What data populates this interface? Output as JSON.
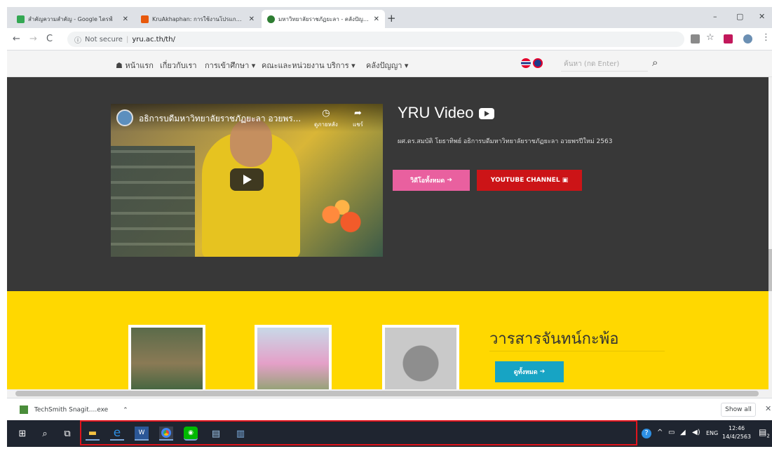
{
  "browser": {
    "tabs": [
      {
        "title": "สำคัญความสำคัญ - Google ไดรฟ์",
        "color": "#34a853",
        "active": false
      },
      {
        "title": "KruAkhaphan: การใช้งานโปรแกรม Fr",
        "color": "#e8590c",
        "active": false
      },
      {
        "title": "มหาวิทยาลัยราชภัฏยะลา - คลังปัญญา",
        "color": "#2e7d32",
        "active": true
      }
    ],
    "new_tab": "+",
    "window_controls": {
      "minimize": "–",
      "maximize": "▢",
      "close": "✕"
    },
    "nav": {
      "back": "←",
      "forward": "→",
      "reload": "C"
    },
    "address": {
      "security_label": "Not secure",
      "url": "yru.ac.th/th/"
    }
  },
  "site_nav": {
    "items": [
      {
        "label": "หน้าแรก",
        "home": true
      },
      {
        "label": "เกี่ยวกับเรา",
        "dropdown": false
      },
      {
        "label": "การเข้าศึกษา",
        "dropdown": true
      },
      {
        "label": "คณะและหน่วยงาน",
        "dropdown": false
      },
      {
        "label": "บริการ",
        "dropdown": true
      },
      {
        "label": "คลังปัญญา",
        "dropdown": true
      }
    ],
    "search_placeholder": "ค้นหา (กด Enter)"
  },
  "video": {
    "heading": "YRU Video",
    "embed_title": "อธิการบดีมหาวิทยาลัยราชภัฏยะลา อวยพร...",
    "watch_later": "ดูภายหลัง",
    "share": "แชร์",
    "description": "ผศ.ดร.สมบัติ โยธาทิพย์ อธิการบดีมหาวิทยาลัยราชภัฏยะลา อวยพรปีใหม่ 2563",
    "all_videos_label": "วิดีโอทั้งหมด",
    "youtube_channel_label": "YOUTUBE CHANNEL",
    "colors": {
      "all_videos": "#e9609f",
      "youtube": "#cc1417"
    }
  },
  "journal": {
    "title": "วารสารจันทน์กะพ้อ",
    "view_all_label": "ดูทั้งหมด",
    "button_color": "#17a4c4"
  },
  "downloads": {
    "file": "TechSmith Snagit....exe",
    "show_all": "Show all",
    "close": "✕"
  },
  "taskbar": {
    "apps": [
      "start-icon",
      "search-icon",
      "task-view-icon",
      "file-explorer-icon",
      "edge-icon",
      "word-icon",
      "chrome-icon",
      "line-icon",
      "notes-icon",
      "app-icon"
    ],
    "tray_language": "ENG",
    "time": "12:46",
    "date": "14/4/2563",
    "notification_count": "2"
  }
}
